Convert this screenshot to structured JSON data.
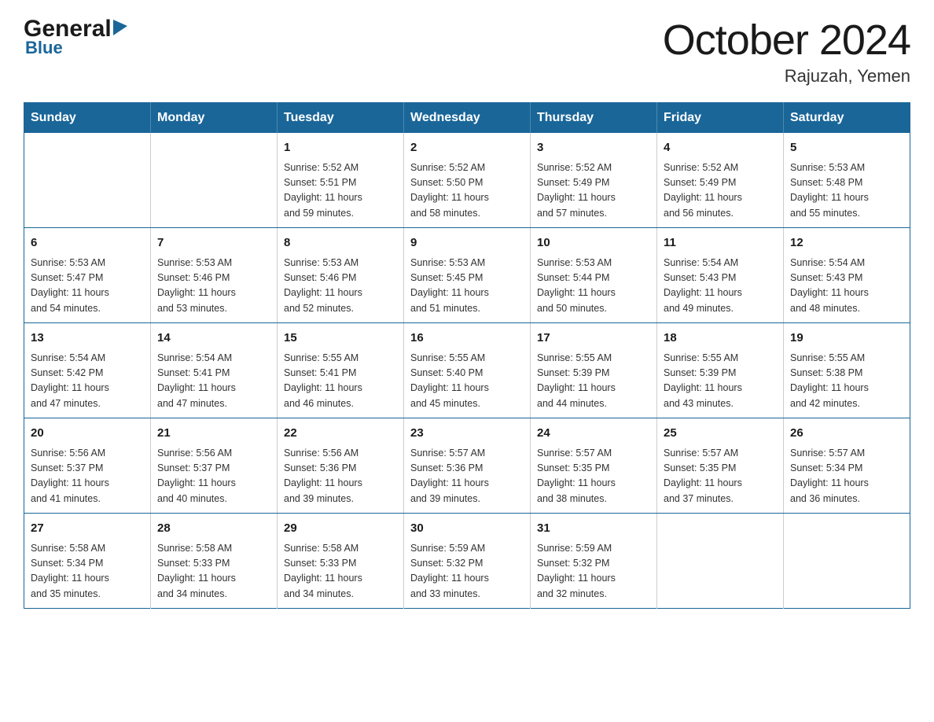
{
  "header": {
    "logo_general": "General",
    "logo_blue": "Blue",
    "month_title": "October 2024",
    "location": "Rajuzah, Yemen"
  },
  "weekdays": [
    "Sunday",
    "Monday",
    "Tuesday",
    "Wednesday",
    "Thursday",
    "Friday",
    "Saturday"
  ],
  "weeks": [
    [
      {
        "day": "",
        "info": ""
      },
      {
        "day": "",
        "info": ""
      },
      {
        "day": "1",
        "info": "Sunrise: 5:52 AM\nSunset: 5:51 PM\nDaylight: 11 hours\nand 59 minutes."
      },
      {
        "day": "2",
        "info": "Sunrise: 5:52 AM\nSunset: 5:50 PM\nDaylight: 11 hours\nand 58 minutes."
      },
      {
        "day": "3",
        "info": "Sunrise: 5:52 AM\nSunset: 5:49 PM\nDaylight: 11 hours\nand 57 minutes."
      },
      {
        "day": "4",
        "info": "Sunrise: 5:52 AM\nSunset: 5:49 PM\nDaylight: 11 hours\nand 56 minutes."
      },
      {
        "day": "5",
        "info": "Sunrise: 5:53 AM\nSunset: 5:48 PM\nDaylight: 11 hours\nand 55 minutes."
      }
    ],
    [
      {
        "day": "6",
        "info": "Sunrise: 5:53 AM\nSunset: 5:47 PM\nDaylight: 11 hours\nand 54 minutes."
      },
      {
        "day": "7",
        "info": "Sunrise: 5:53 AM\nSunset: 5:46 PM\nDaylight: 11 hours\nand 53 minutes."
      },
      {
        "day": "8",
        "info": "Sunrise: 5:53 AM\nSunset: 5:46 PM\nDaylight: 11 hours\nand 52 minutes."
      },
      {
        "day": "9",
        "info": "Sunrise: 5:53 AM\nSunset: 5:45 PM\nDaylight: 11 hours\nand 51 minutes."
      },
      {
        "day": "10",
        "info": "Sunrise: 5:53 AM\nSunset: 5:44 PM\nDaylight: 11 hours\nand 50 minutes."
      },
      {
        "day": "11",
        "info": "Sunrise: 5:54 AM\nSunset: 5:43 PM\nDaylight: 11 hours\nand 49 minutes."
      },
      {
        "day": "12",
        "info": "Sunrise: 5:54 AM\nSunset: 5:43 PM\nDaylight: 11 hours\nand 48 minutes."
      }
    ],
    [
      {
        "day": "13",
        "info": "Sunrise: 5:54 AM\nSunset: 5:42 PM\nDaylight: 11 hours\nand 47 minutes."
      },
      {
        "day": "14",
        "info": "Sunrise: 5:54 AM\nSunset: 5:41 PM\nDaylight: 11 hours\nand 47 minutes."
      },
      {
        "day": "15",
        "info": "Sunrise: 5:55 AM\nSunset: 5:41 PM\nDaylight: 11 hours\nand 46 minutes."
      },
      {
        "day": "16",
        "info": "Sunrise: 5:55 AM\nSunset: 5:40 PM\nDaylight: 11 hours\nand 45 minutes."
      },
      {
        "day": "17",
        "info": "Sunrise: 5:55 AM\nSunset: 5:39 PM\nDaylight: 11 hours\nand 44 minutes."
      },
      {
        "day": "18",
        "info": "Sunrise: 5:55 AM\nSunset: 5:39 PM\nDaylight: 11 hours\nand 43 minutes."
      },
      {
        "day": "19",
        "info": "Sunrise: 5:55 AM\nSunset: 5:38 PM\nDaylight: 11 hours\nand 42 minutes."
      }
    ],
    [
      {
        "day": "20",
        "info": "Sunrise: 5:56 AM\nSunset: 5:37 PM\nDaylight: 11 hours\nand 41 minutes."
      },
      {
        "day": "21",
        "info": "Sunrise: 5:56 AM\nSunset: 5:37 PM\nDaylight: 11 hours\nand 40 minutes."
      },
      {
        "day": "22",
        "info": "Sunrise: 5:56 AM\nSunset: 5:36 PM\nDaylight: 11 hours\nand 39 minutes."
      },
      {
        "day": "23",
        "info": "Sunrise: 5:57 AM\nSunset: 5:36 PM\nDaylight: 11 hours\nand 39 minutes."
      },
      {
        "day": "24",
        "info": "Sunrise: 5:57 AM\nSunset: 5:35 PM\nDaylight: 11 hours\nand 38 minutes."
      },
      {
        "day": "25",
        "info": "Sunrise: 5:57 AM\nSunset: 5:35 PM\nDaylight: 11 hours\nand 37 minutes."
      },
      {
        "day": "26",
        "info": "Sunrise: 5:57 AM\nSunset: 5:34 PM\nDaylight: 11 hours\nand 36 minutes."
      }
    ],
    [
      {
        "day": "27",
        "info": "Sunrise: 5:58 AM\nSunset: 5:34 PM\nDaylight: 11 hours\nand 35 minutes."
      },
      {
        "day": "28",
        "info": "Sunrise: 5:58 AM\nSunset: 5:33 PM\nDaylight: 11 hours\nand 34 minutes."
      },
      {
        "day": "29",
        "info": "Sunrise: 5:58 AM\nSunset: 5:33 PM\nDaylight: 11 hours\nand 34 minutes."
      },
      {
        "day": "30",
        "info": "Sunrise: 5:59 AM\nSunset: 5:32 PM\nDaylight: 11 hours\nand 33 minutes."
      },
      {
        "day": "31",
        "info": "Sunrise: 5:59 AM\nSunset: 5:32 PM\nDaylight: 11 hours\nand 32 minutes."
      },
      {
        "day": "",
        "info": ""
      },
      {
        "day": "",
        "info": ""
      }
    ]
  ]
}
